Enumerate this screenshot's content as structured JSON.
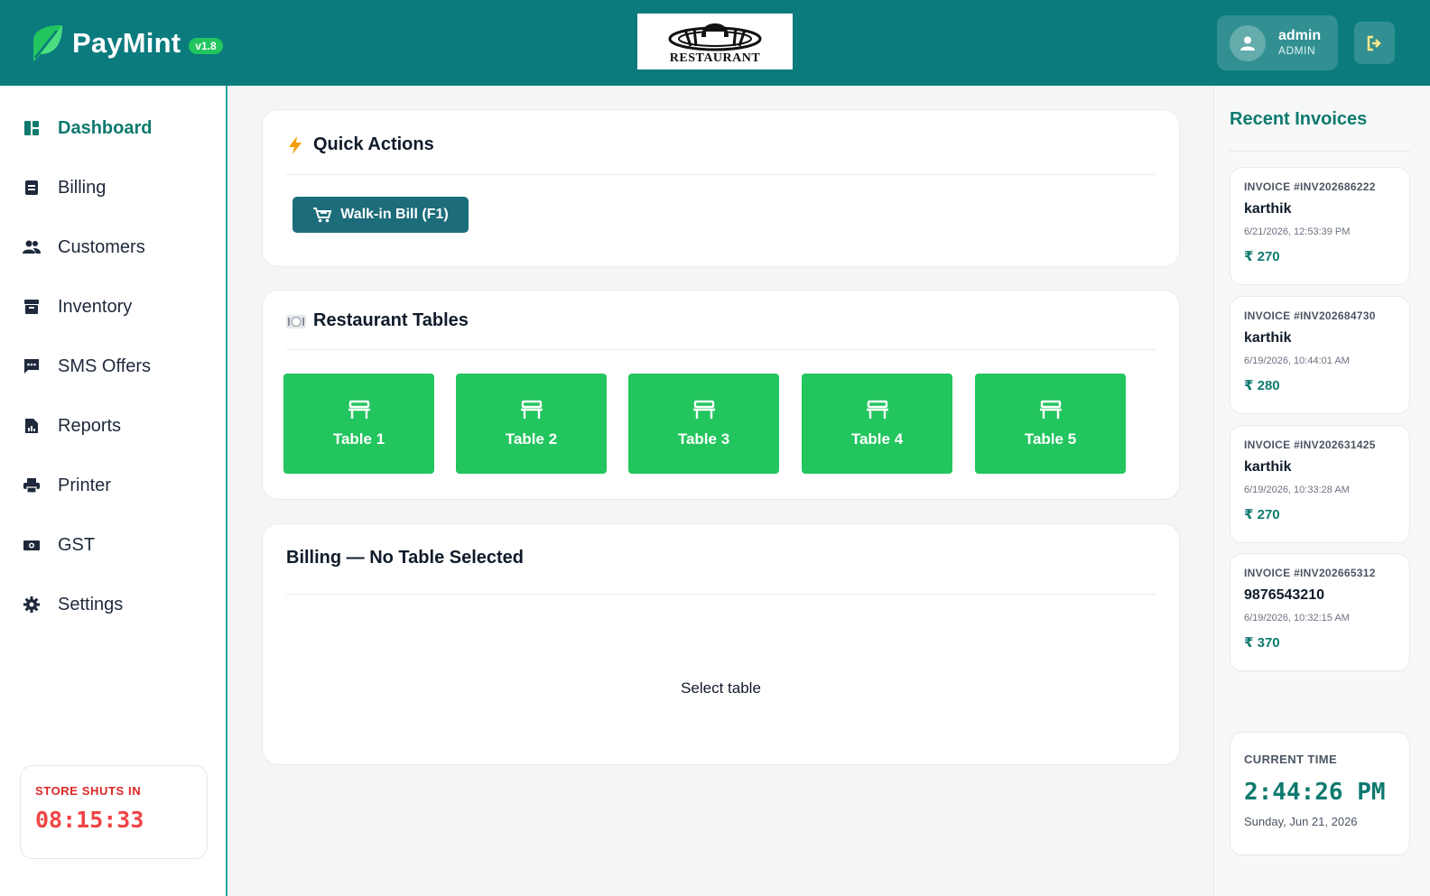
{
  "header": {
    "brand_name": "PayMint",
    "version": "v1.8",
    "restaurant_logo_text": "RESTAURANT",
    "user_name": "admin",
    "user_role": "ADMIN",
    "logout_icon": "logout-icon"
  },
  "sidebar": {
    "items": [
      {
        "label": "Dashboard",
        "icon": "dashboard-icon",
        "active": true
      },
      {
        "label": "Billing",
        "icon": "billing-icon",
        "active": false
      },
      {
        "label": "Customers",
        "icon": "customers-icon",
        "active": false
      },
      {
        "label": "Inventory",
        "icon": "inventory-icon",
        "active": false
      },
      {
        "label": "SMS Offers",
        "icon": "sms-icon",
        "active": false
      },
      {
        "label": "Reports",
        "icon": "reports-icon",
        "active": false
      },
      {
        "label": "Printer",
        "icon": "printer-icon",
        "active": false
      },
      {
        "label": "GST",
        "icon": "gst-icon",
        "active": false
      },
      {
        "label": "Settings",
        "icon": "settings-icon",
        "active": false
      }
    ],
    "store_shuts_label": "STORE SHUTS IN",
    "store_shuts_timer": "08:15:33"
  },
  "quick_actions": {
    "title": "Quick Actions",
    "walkin_label": "Walk-in Bill (F1)"
  },
  "restaurant_tables": {
    "title": "Restaurant Tables",
    "tables": [
      "Table 1",
      "Table 2",
      "Table 3",
      "Table 4",
      "Table 5"
    ]
  },
  "billing": {
    "title": "Billing — No Table Selected",
    "empty_message": "Select table"
  },
  "recent_invoices": {
    "title": "Recent Invoices",
    "items": [
      {
        "id": "INVOICE #INV202686222",
        "customer": "karthik",
        "date": "6/21/2026, 12:53:39 PM",
        "amount": "₹ 270"
      },
      {
        "id": "INVOICE #INV202684730",
        "customer": "karthik",
        "date": "6/19/2026, 10:44:01 AM",
        "amount": "₹ 280"
      },
      {
        "id": "INVOICE #INV202631425",
        "customer": "karthik",
        "date": "6/19/2026, 10:33:28 AM",
        "amount": "₹ 270"
      },
      {
        "id": "INVOICE #INV202665312",
        "customer": "9876543210",
        "date": "6/19/2026, 10:32:15 AM",
        "amount": "₹ 370"
      }
    ]
  },
  "clock": {
    "label": "CURRENT TIME",
    "time": "2:44:26 PM",
    "date": "Sunday, Jun 21, 2026"
  },
  "colors": {
    "header": "#0b7b7e",
    "accent": "#0e7a6e",
    "table_green": "#22c55e",
    "walkin_button": "#1c6c7a",
    "alert_red": "#ef4444"
  }
}
